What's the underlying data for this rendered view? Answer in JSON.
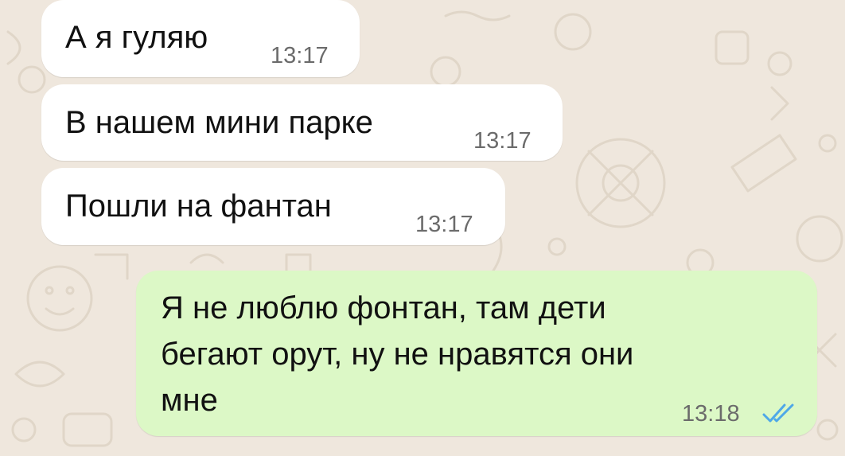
{
  "chat": {
    "messages": [
      {
        "direction": "incoming",
        "text": "А я гуляю",
        "time": "13:17"
      },
      {
        "direction": "incoming",
        "text": "В нашем мини парке",
        "time": "13:17"
      },
      {
        "direction": "incoming",
        "text": "Пошли на фантан",
        "time": "13:17"
      },
      {
        "direction": "outgoing",
        "lines": [
          "Я не люблю фонтан, там дети",
          "бегают орут, ну не нравятся они",
          "мне"
        ],
        "time": "13:18",
        "status_icon": "double-check-read-icon",
        "status_color": "#4fa8e8"
      }
    ]
  },
  "colors": {
    "background": "#efe7dd",
    "incoming_bubble": "#ffffff",
    "outgoing_bubble": "#dcf8c6",
    "text": "#111111",
    "time": "#6b6b6b"
  }
}
